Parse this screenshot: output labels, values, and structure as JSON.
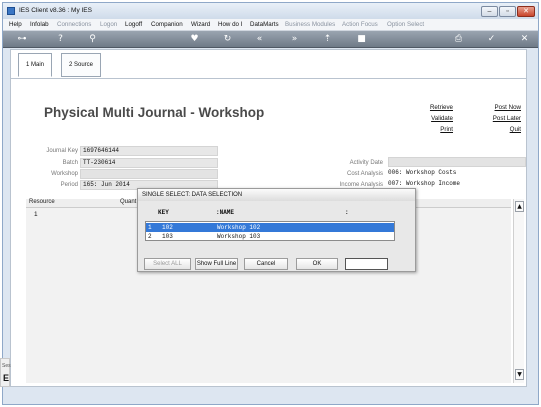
{
  "window": {
    "title": "IES Client v8.36 : My IES"
  },
  "menu": {
    "items": [
      {
        "label": "Help",
        "enabled": true
      },
      {
        "label": "Infolab",
        "enabled": true
      },
      {
        "label": "Connections",
        "enabled": false
      },
      {
        "label": "Logon",
        "enabled": false
      },
      {
        "label": "Logoff",
        "enabled": true
      },
      {
        "label": "Companion",
        "enabled": true
      },
      {
        "label": "Wizard",
        "enabled": true
      },
      {
        "label": "How do I",
        "enabled": true
      },
      {
        "label": "DataMarts",
        "enabled": true
      },
      {
        "label": "Business Modules",
        "enabled": false
      },
      {
        "label": "Action Focus",
        "enabled": false
      },
      {
        "label": "Option Select",
        "enabled": false
      }
    ]
  },
  "toolbar": {
    "icons": [
      "key-icon",
      "help-icon",
      "search-icon",
      "heart-icon",
      "refresh-icon",
      "back-icon",
      "forward-icon",
      "upload-icon",
      "stop-icon",
      "print-icon",
      "check-icon",
      "close-icon"
    ]
  },
  "tabs": [
    {
      "label": "1 Main",
      "active": true
    },
    {
      "label": "2 Source",
      "active": false
    }
  ],
  "form": {
    "title": "Physical Multi Journal - Workshop",
    "actions_left": [
      "Retrieve",
      "Validate",
      "Print"
    ],
    "actions_right": [
      "Post Now",
      "Post Later",
      "Quit"
    ],
    "fields": {
      "journal_key": {
        "label": "Journal Key",
        "value": "1697646144"
      },
      "batch": {
        "label": "Batch",
        "value": "TT-230614"
      },
      "workshop": {
        "label": "Workshop",
        "value": ""
      },
      "period": {
        "label": "Period",
        "value": "165: Jun 2014"
      },
      "activity_date": {
        "label": "Activity Date",
        "value": ""
      },
      "cost_analysis": {
        "label": "Cost Analysis",
        "value": "006: Workshop Costs"
      },
      "income_analysis": {
        "label": "Income Analysis",
        "value": "007: Workshop Income"
      }
    },
    "grid": {
      "columns": [
        "Resource",
        "Quant"
      ],
      "rows": [
        "1"
      ]
    },
    "side_fragment": "Ses"
  },
  "modal": {
    "title": "SINGLE SELECT: DATA SELECTION",
    "columns": [
      "KEY",
      ":NAME",
      ":"
    ],
    "rows": [
      {
        "num": "1",
        "key": "102",
        "name": "Workshop 102",
        "selected": true
      },
      {
        "num": "2",
        "key": "103",
        "name": "Workshop 103",
        "selected": false
      }
    ],
    "buttons": {
      "select_all": "Select ALL",
      "show_full_line": "Show Full Line",
      "cancel": "Cancel",
      "ok": "OK",
      "blank": ""
    }
  }
}
